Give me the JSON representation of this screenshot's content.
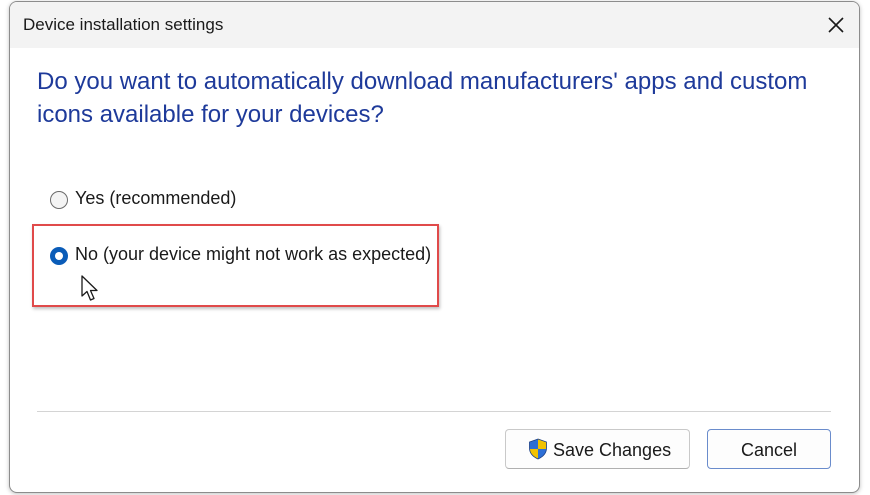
{
  "window": {
    "title": "Device installation settings"
  },
  "question": "Do you want to automatically download manufacturers' apps and custom icons available for your devices?",
  "options": [
    {
      "label": "Yes (recommended)",
      "selected": false
    },
    {
      "label": "No (your device might not work as expected)",
      "selected": true
    }
  ],
  "buttons": {
    "save_label": "Save Changes",
    "cancel_label": "Cancel"
  },
  "colors": {
    "question_text": "#1e3a9a",
    "radio_selected": "#0a5cb8",
    "highlight_border": "#e04a4a"
  },
  "icons": {
    "close": "close-icon",
    "save": "uac-shield-icon",
    "pointer": "mouse-cursor-icon"
  }
}
